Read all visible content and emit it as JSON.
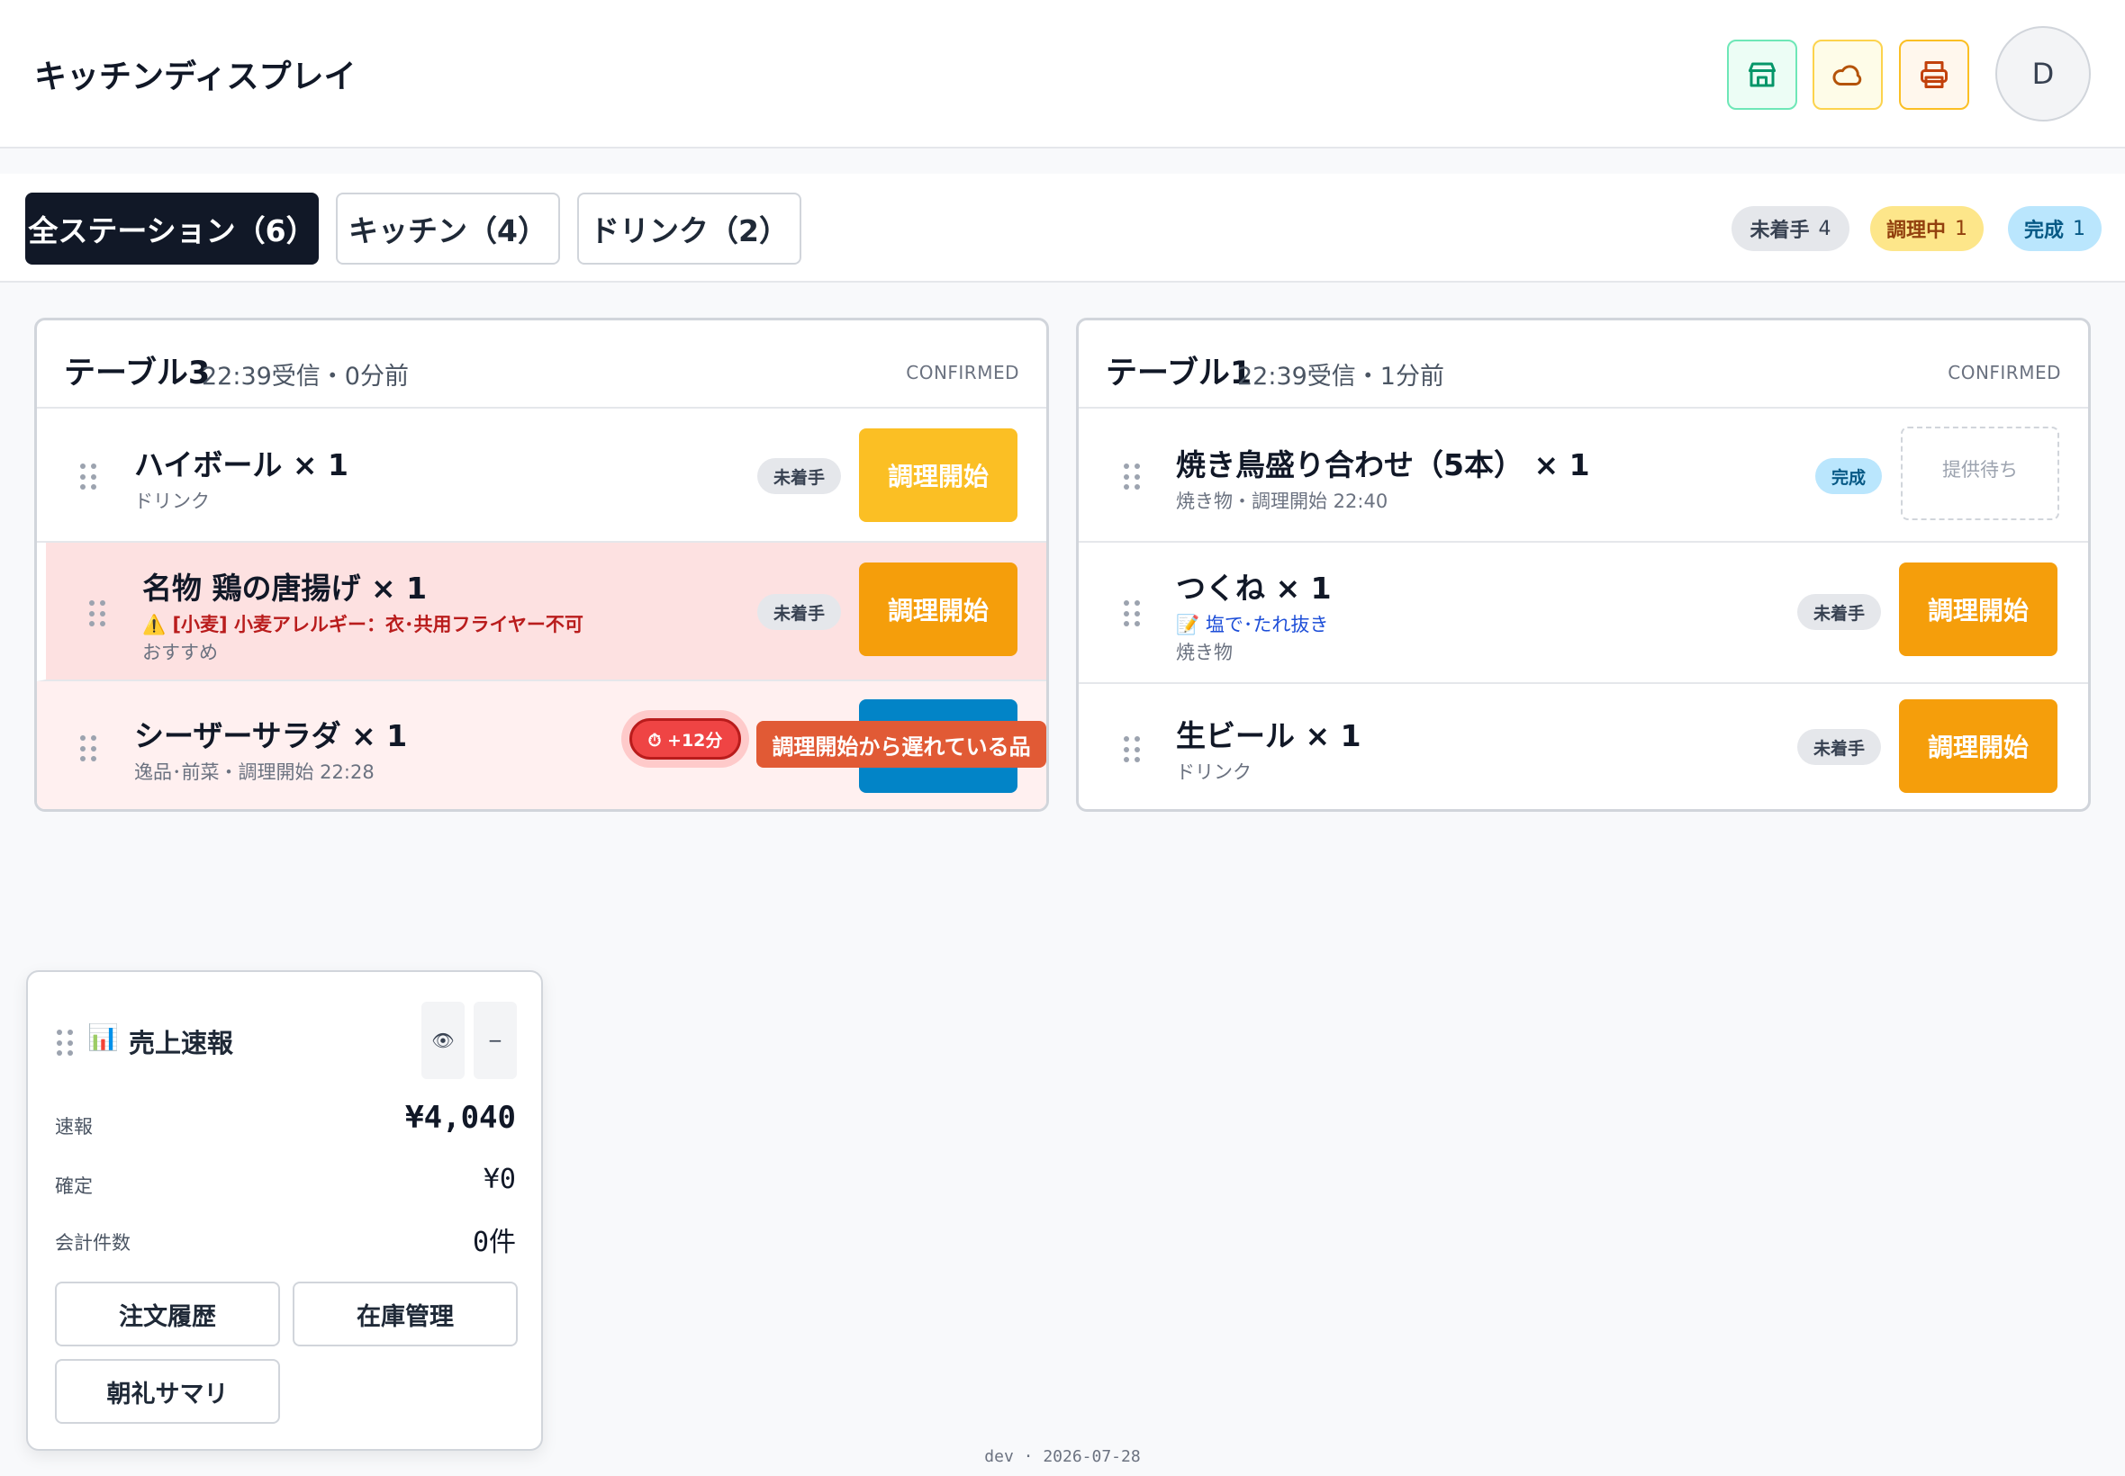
{
  "header": {
    "title": "キッチンディスプレイ",
    "buttons": [
      "store-icon",
      "cloud-icon",
      "printer-icon"
    ],
    "avatar_initial": "D"
  },
  "tabs": [
    {
      "label": "全ステーション（6）"
    },
    {
      "label": "キッチン（4）"
    },
    {
      "label": "ドリンク（2）"
    }
  ],
  "summary": {
    "pending": {
      "label": "未着手",
      "count": "4"
    },
    "cooking": {
      "label": "調理中",
      "count": "1"
    },
    "done": {
      "label": "完成",
      "count": "1"
    }
  },
  "tickets": [
    {
      "table": "テーブル3",
      "meta": "22:39受信・0分前",
      "status": "CONFIRMED",
      "items": [
        {
          "name": "ハイボール × 1",
          "sub": "ドリンク",
          "badge": "未着手",
          "action": "調理開始"
        },
        {
          "name": "名物 鶏の唐揚げ × 1",
          "allergy": "⚠️ [小麦] 小麦アレルギー：衣･共用フライヤー不可",
          "sub": "おすすめ",
          "badge": "未着手",
          "action": "調理開始"
        },
        {
          "name": "シーザーサラダ × 1",
          "sub": "逸品･前菜・調理開始 22:28",
          "timer": "⏱ +12分",
          "tooltip": "調理開始から遅れている品"
        }
      ]
    },
    {
      "table": "テーブル1",
      "meta": "22:39受信・1分前",
      "status": "CONFIRMED",
      "items": [
        {
          "name": "焼き鳥盛り合わせ（5本） × 1",
          "sub": "焼き物・調理開始 22:40",
          "badge": "完成",
          "action": "提供待ち"
        },
        {
          "name": "つくね × 1",
          "note": "📝 塩で･たれ抜き",
          "sub": "焼き物",
          "badge": "未着手",
          "action": "調理開始"
        },
        {
          "name": "生ビール × 1",
          "sub": "ドリンク",
          "badge": "未着手",
          "action": "調理開始"
        }
      ]
    }
  ],
  "sales_widget": {
    "icon": "📊",
    "title": "売上速報",
    "eye_icon": "👁",
    "minimize": "−",
    "rows": [
      {
        "label": "速報",
        "value": "¥4,040"
      },
      {
        "label": "確定",
        "value": "¥0"
      },
      {
        "label": "会計件数",
        "value": "0件"
      }
    ],
    "buttons": [
      "注文履歴",
      "在庫管理",
      "朝礼サマリ"
    ]
  },
  "footer": "dev · 2026-07-28"
}
